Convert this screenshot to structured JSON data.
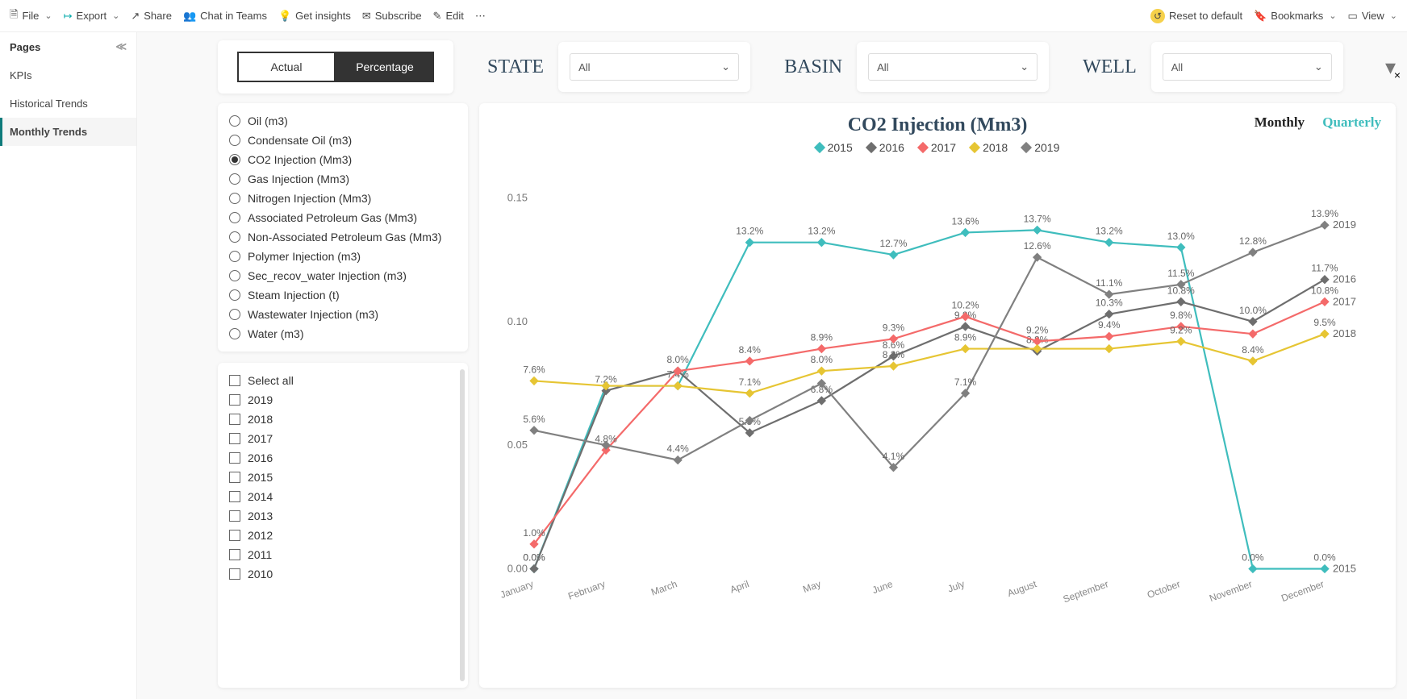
{
  "topbar": {
    "file": "File",
    "export": "Export",
    "share": "Share",
    "chat": "Chat in Teams",
    "insights": "Get insights",
    "subscribe": "Subscribe",
    "edit": "Edit",
    "reset": "Reset to default",
    "bookmarks": "Bookmarks",
    "view": "View"
  },
  "sidebar": {
    "title": "Pages",
    "items": [
      {
        "label": "KPIs"
      },
      {
        "label": "Historical Trends"
      },
      {
        "label": "Monthly Trends"
      }
    ],
    "active_index": 2
  },
  "toggle": {
    "actual": "Actual",
    "percentage": "Percentage"
  },
  "filters": {
    "state_label": "STATE",
    "state_value": "All",
    "basin_label": "BASIN",
    "basin_value": "All",
    "well_label": "WELL",
    "well_value": "All"
  },
  "metrics": {
    "items": [
      "Oil (m3)",
      "Condensate Oil (m3)",
      "CO2 Injection (Mm3)",
      "Gas Injection (Mm3)",
      "Nitrogen Injection (Mm3)",
      "Associated Petroleum Gas (Mm3)",
      "Non-Associated Petroleum Gas (Mm3)",
      "Polymer Injection (m3)",
      "Sec_recov_water Injection (m3)",
      "Steam Injection (t)",
      "Wastewater Injection (m3)",
      "Water (m3)"
    ],
    "selected_index": 2
  },
  "years": {
    "select_all": "Select all",
    "items": [
      "2019",
      "2018",
      "2017",
      "2016",
      "2015",
      "2014",
      "2013",
      "2012",
      "2011",
      "2010"
    ]
  },
  "chart": {
    "title": "CO2 Injection (Mm3)",
    "monthly": "Monthly",
    "quarterly": "Quarterly"
  },
  "chart_data": {
    "type": "line",
    "categories": [
      "January",
      "February",
      "March",
      "April",
      "May",
      "June",
      "July",
      "August",
      "September",
      "October",
      "November",
      "December"
    ],
    "ylim": [
      0,
      0.15
    ],
    "yticks": [
      0.0,
      0.05,
      0.1,
      0.15
    ],
    "yticklabels": [
      "0.00",
      "0.05",
      "0.10",
      "0.15"
    ],
    "ylabel": "",
    "xlabel": "",
    "legend_position": "top",
    "series": [
      {
        "name": "2015",
        "color": "#3fbdbd",
        "marker": "diamond",
        "values": [
          0.0,
          0.074,
          0.074,
          0.132,
          0.132,
          0.127,
          0.136,
          0.137,
          0.132,
          0.13,
          0.0,
          0.0
        ],
        "labels": [
          "0.0%",
          null,
          "7.4%",
          "13.2%",
          "13.2%",
          "12.7%",
          "13.6%",
          "13.7%",
          "13.2%",
          "13.0%",
          "0.0%",
          "0.0%"
        ]
      },
      {
        "name": "2016",
        "color": "#6e6e6e",
        "marker": "diamond",
        "values": [
          0.0,
          0.072,
          0.08,
          0.055,
          0.068,
          0.086,
          0.098,
          0.088,
          0.103,
          0.108,
          0.1,
          0.117
        ],
        "labels": [
          "0.0%",
          "7.2%",
          "8.0%",
          "5.5%",
          "6.8%",
          "8.6%",
          "9.8%",
          "8.8%",
          "10.3%",
          "10.8%",
          "10.0%",
          "11.7%"
        ]
      },
      {
        "name": "2017",
        "color": "#f46a6a",
        "marker": "diamond",
        "values": [
          0.01,
          0.048,
          0.08,
          0.084,
          0.089,
          0.093,
          0.102,
          0.092,
          0.094,
          0.098,
          0.095,
          0.108
        ],
        "labels": [
          "1.0%",
          "4.8%",
          null,
          "8.4%",
          "8.9%",
          "9.3%",
          "10.2%",
          "9.2%",
          "9.4%",
          "9.8%",
          null,
          "10.8%"
        ]
      },
      {
        "name": "2018",
        "color": "#e6c533",
        "marker": "diamond",
        "values": [
          0.076,
          0.074,
          0.074,
          0.071,
          0.08,
          0.082,
          0.089,
          0.089,
          0.089,
          0.092,
          0.084,
          0.095
        ],
        "labels": [
          "7.6%",
          null,
          null,
          "7.1%",
          "8.0%",
          "8.2%",
          "8.9%",
          null,
          null,
          "9.2%",
          "8.4%",
          "9.5%"
        ]
      },
      {
        "name": "2019",
        "color": "#808080",
        "marker": "diamond",
        "values": [
          0.056,
          0.05,
          0.044,
          0.06,
          0.075,
          0.041,
          0.071,
          0.126,
          0.111,
          0.115,
          0.128,
          0.139
        ],
        "labels": [
          "5.6%",
          null,
          "4.4%",
          null,
          null,
          "4.1%",
          "7.1%",
          "12.6%",
          "11.1%",
          "11.5%",
          "12.8%",
          "13.9%"
        ]
      }
    ],
    "series_end_labels": [
      {
        "name": "2019",
        "y": 0.139
      },
      {
        "name": "2016",
        "y": 0.117
      },
      {
        "name": "2017",
        "y": 0.108
      },
      {
        "name": "2018",
        "y": 0.095
      },
      {
        "name": "2015",
        "y": 0.0
      }
    ]
  }
}
